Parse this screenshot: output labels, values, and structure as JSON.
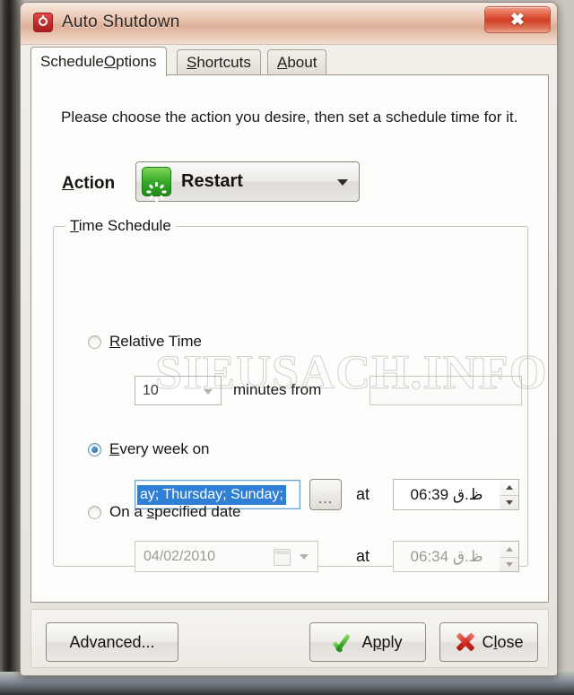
{
  "window": {
    "title": "Auto Shutdown",
    "app_icon": "clock-icon",
    "close_glyph": "✖"
  },
  "tabs": [
    {
      "label_pre": "Schedule ",
      "mnemonic": "O",
      "label_post": "ptions",
      "active": true,
      "name": "schedule-options"
    },
    {
      "label_pre": "",
      "mnemonic": "S",
      "label_post": "hortcuts",
      "active": false,
      "name": "shortcuts"
    },
    {
      "label_pre": "",
      "mnemonic": "A",
      "label_post": "bout",
      "active": false,
      "name": "about"
    }
  ],
  "page": {
    "instruction": "Please choose the action you desire, then set a schedule time for it.",
    "watermark": "SIEUSACH.INFO"
  },
  "action": {
    "label_mnemonic": "A",
    "label_rest": "ction",
    "value": "Restart",
    "icon": "restart-icon"
  },
  "time_schedule": {
    "legend_mnemonic": "T",
    "legend_rest": "ime Schedule",
    "relative": {
      "selected": false,
      "label_mnemonic": "R",
      "label_rest": "elative Time",
      "minutes_value": "10",
      "minutes_suffix": "minutes from",
      "from_value": ""
    },
    "weekly": {
      "selected": true,
      "label_pre": "",
      "label_mnemonic": "E",
      "label_rest": "very week on",
      "days_value": "ay; Thursday; Sunday;",
      "browse_label": "...",
      "at_label": "at",
      "time_value": "06:39 ظ.ق"
    },
    "specified_date": {
      "selected": false,
      "label_pre": "On a ",
      "label_mnemonic": "s",
      "label_rest": "pecified date",
      "date_value": "04/02/2010",
      "at_label": "at",
      "time_value": "06:34 ظ.ق"
    }
  },
  "footer": {
    "advanced_label": "Advanced...",
    "apply_pre": "A",
    "apply_mnemonic": "p",
    "apply_post": "ply",
    "close_pre": "C",
    "close_mnemonic": "l",
    "close_post": "ose"
  },
  "colors": {
    "accent_selection": "#2f7fd6",
    "title_gradient": "#dcae96",
    "close_red": "#cf3f24",
    "restart_green": "#37a928"
  }
}
